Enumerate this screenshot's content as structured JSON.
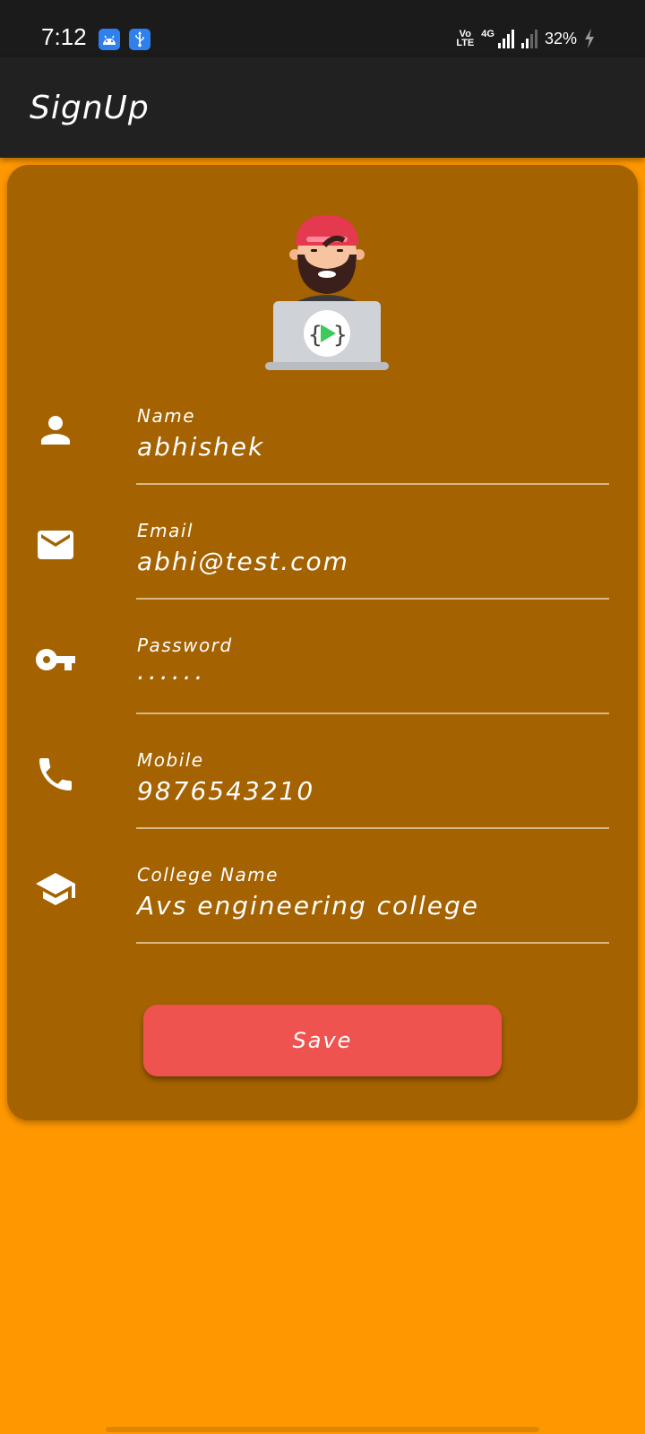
{
  "status_bar": {
    "time": "7:12",
    "volte": "Vo\nLTE",
    "network": "4G",
    "battery": "32%",
    "icons": [
      "android-icon",
      "usb-icon",
      "signal-icon",
      "battery-charging-icon"
    ]
  },
  "app_bar": {
    "title": "SignUp"
  },
  "colors": {
    "background": "#ff9800",
    "card": "#a46200",
    "app_bar": "#212121",
    "button": "#ef5350",
    "text": "#ffffff"
  },
  "form": {
    "fields": [
      {
        "label": "Name",
        "value": "abhishek",
        "icon": "person-icon"
      },
      {
        "label": "Email",
        "value": "abhi@test.com",
        "icon": "email-icon"
      },
      {
        "label": "Password",
        "value": "......",
        "icon": "key-icon"
      },
      {
        "label": "Mobile",
        "value": "9876543210",
        "icon": "phone-icon"
      },
      {
        "label": "College Name",
        "value": "Avs engineering college",
        "icon": "graduation-cap-icon"
      }
    ],
    "save_label": "Save"
  }
}
